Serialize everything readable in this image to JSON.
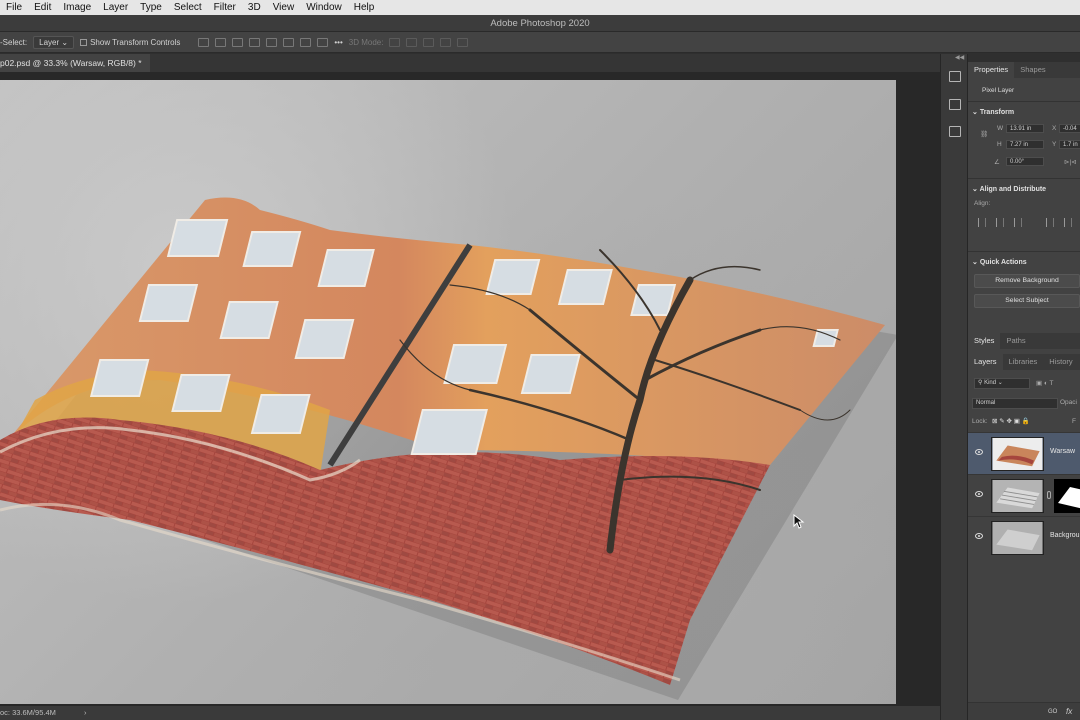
{
  "menubar": {
    "items": [
      "File",
      "Edit",
      "Image",
      "Layer",
      "Type",
      "Select",
      "Filter",
      "3D",
      "View",
      "Window",
      "Help"
    ]
  },
  "window_title": "Adobe Photoshop 2020",
  "options": {
    "autoselect_label": "-Select:",
    "autoselect_value": "Layer",
    "transform_controls": "Show Transform Controls",
    "mode3d": "3D Mode:",
    "more": "•••"
  },
  "document_tab": "p02.psd @ 33.3% (Warsaw, RGB/8) *",
  "status": {
    "doc": "oc: 33.6M/95.4M",
    "arrow": "›"
  },
  "panels": {
    "properties_tabs": [
      "Properties",
      "Shapes"
    ],
    "pixel_layer": "Pixel Layer",
    "transform": {
      "title": "Transform",
      "w_label": "W",
      "w_value": "13.91 in",
      "h_label": "H",
      "h_value": "7.27 in",
      "x_label": "X",
      "x_value": "-0.04",
      "y_label": "Y",
      "y_value": "1.7 in",
      "angle_value": "0.00°"
    },
    "align": {
      "title": "Align and Distribute",
      "label": "Align:"
    },
    "quick_actions": {
      "title": "Quick Actions",
      "remove_bg": "Remove Background",
      "select_subject": "Select Subject"
    },
    "styles_tabs": [
      "Styles",
      "Paths"
    ],
    "layers_tabs": [
      "Layers",
      "Libraries",
      "History"
    ],
    "layers": {
      "filter": "Kind",
      "blend_mode": "Normal",
      "opacity_label": "Opaci",
      "lock_label": "Lock:",
      "fill_label": "F",
      "items": [
        {
          "name": "Warsaw"
        },
        {
          "name": ""
        },
        {
          "name": "Backgrou"
        }
      ]
    },
    "footer": {
      "link": "GO",
      "fx": "fx"
    }
  },
  "colors": {
    "accent_selected": "#4e5a6d",
    "panel_bg": "#424242",
    "menubar_bg": "#e6e6e6"
  }
}
